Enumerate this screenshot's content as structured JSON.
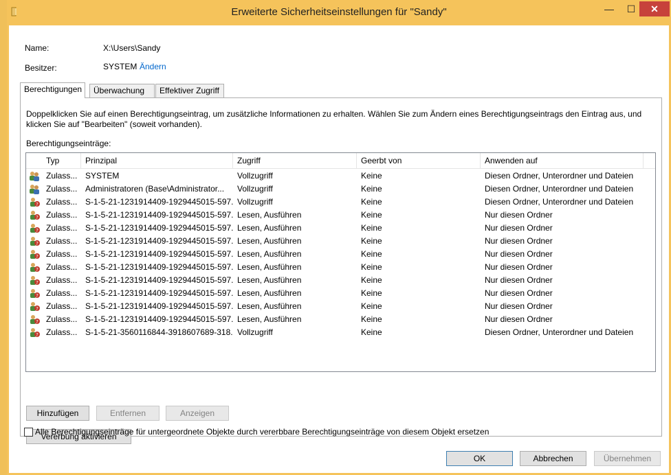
{
  "window": {
    "title": "Erweiterte Sicherheitseinstellungen für \"Sandy\"",
    "min_glyph": "—",
    "max_glyph": "☐",
    "close_glyph": "✕"
  },
  "info": {
    "name_label": "Name:",
    "name_value": "X:\\Users\\Sandy",
    "owner_label": "Besitzer:",
    "owner_value": "SYSTEM",
    "owner_change_link": "Ändern"
  },
  "tabs": [
    {
      "label": "Berechtigungen",
      "active": true
    },
    {
      "label": "Überwachung",
      "active": false
    },
    {
      "label": "Effektiver Zugriff",
      "active": false
    }
  ],
  "permissions": {
    "description": "Doppelklicken Sie auf einen Berechtigungseintrag, um zusätzliche Informationen zu erhalten. Wählen Sie zum Ändern eines Berechtigungseintrags den Eintrag aus, und klicken Sie auf \"Bearbeiten\" (soweit vorhanden).",
    "entries_label": "Berechtigungseinträge:",
    "columns": [
      "Typ",
      "Prinzipal",
      "Zugriff",
      "Geerbt von",
      "Anwenden auf"
    ],
    "rows": [
      {
        "icon": "users-group-icon",
        "type": "Zulass...",
        "principal": "SYSTEM",
        "access": "Vollzugriff",
        "inherited": "Keine",
        "applies": "Diesen Ordner, Unterordner und Dateien"
      },
      {
        "icon": "users-group-icon",
        "type": "Zulass...",
        "principal": "Administratoren (Base\\Administrator...",
        "access": "Vollzugriff",
        "inherited": "Keine",
        "applies": "Diesen Ordner, Unterordner und Dateien"
      },
      {
        "icon": "unknown-user-icon",
        "type": "Zulass...",
        "principal": "S-1-5-21-1231914409-1929445015-597...",
        "access": "Vollzugriff",
        "inherited": "Keine",
        "applies": "Diesen Ordner, Unterordner und Dateien"
      },
      {
        "icon": "unknown-user-icon",
        "type": "Zulass...",
        "principal": "S-1-5-21-1231914409-1929445015-597...",
        "access": "Lesen, Ausführen",
        "inherited": "Keine",
        "applies": "Nur diesen Ordner"
      },
      {
        "icon": "unknown-user-icon",
        "type": "Zulass...",
        "principal": "S-1-5-21-1231914409-1929445015-597...",
        "access": "Lesen, Ausführen",
        "inherited": "Keine",
        "applies": "Nur diesen Ordner"
      },
      {
        "icon": "unknown-user-icon",
        "type": "Zulass...",
        "principal": "S-1-5-21-1231914409-1929445015-597...",
        "access": "Lesen, Ausführen",
        "inherited": "Keine",
        "applies": "Nur diesen Ordner"
      },
      {
        "icon": "unknown-user-icon",
        "type": "Zulass...",
        "principal": "S-1-5-21-1231914409-1929445015-597...",
        "access": "Lesen, Ausführen",
        "inherited": "Keine",
        "applies": "Nur diesen Ordner"
      },
      {
        "icon": "unknown-user-icon",
        "type": "Zulass...",
        "principal": "S-1-5-21-1231914409-1929445015-597...",
        "access": "Lesen, Ausführen",
        "inherited": "Keine",
        "applies": "Nur diesen Ordner"
      },
      {
        "icon": "unknown-user-icon",
        "type": "Zulass...",
        "principal": "S-1-5-21-1231914409-1929445015-597...",
        "access": "Lesen, Ausführen",
        "inherited": "Keine",
        "applies": "Nur diesen Ordner"
      },
      {
        "icon": "unknown-user-icon",
        "type": "Zulass...",
        "principal": "S-1-5-21-1231914409-1929445015-597...",
        "access": "Lesen, Ausführen",
        "inherited": "Keine",
        "applies": "Nur diesen Ordner"
      },
      {
        "icon": "unknown-user-icon",
        "type": "Zulass...",
        "principal": "S-1-5-21-1231914409-1929445015-597...",
        "access": "Lesen, Ausführen",
        "inherited": "Keine",
        "applies": "Nur diesen Ordner"
      },
      {
        "icon": "unknown-user-icon",
        "type": "Zulass...",
        "principal": "S-1-5-21-1231914409-1929445015-597...",
        "access": "Lesen, Ausführen",
        "inherited": "Keine",
        "applies": "Nur diesen Ordner"
      },
      {
        "icon": "unknown-user-icon",
        "type": "Zulass...",
        "principal": "S-1-5-21-3560116844-3918607689-318...",
        "access": "Vollzugriff",
        "inherited": "Keine",
        "applies": "Diesen Ordner, Unterordner und Dateien"
      }
    ],
    "buttons": {
      "add": "Hinzufügen",
      "remove": "Entfernen",
      "view": "Anzeigen"
    },
    "enable_inheritance": "Vererbung aktivieren",
    "replace_checkbox_label": "Alle Berechtigungseinträge für untergeordnete Objekte durch vererbbare Berechtigungseinträge von diesem Objekt ersetzen",
    "replace_checked": false
  },
  "footer": {
    "ok": "OK",
    "cancel": "Abbrechen",
    "apply": "Übernehmen"
  },
  "colors": {
    "frame": "#f5c35b",
    "close": "#c7423b",
    "link": "#0066cc"
  }
}
